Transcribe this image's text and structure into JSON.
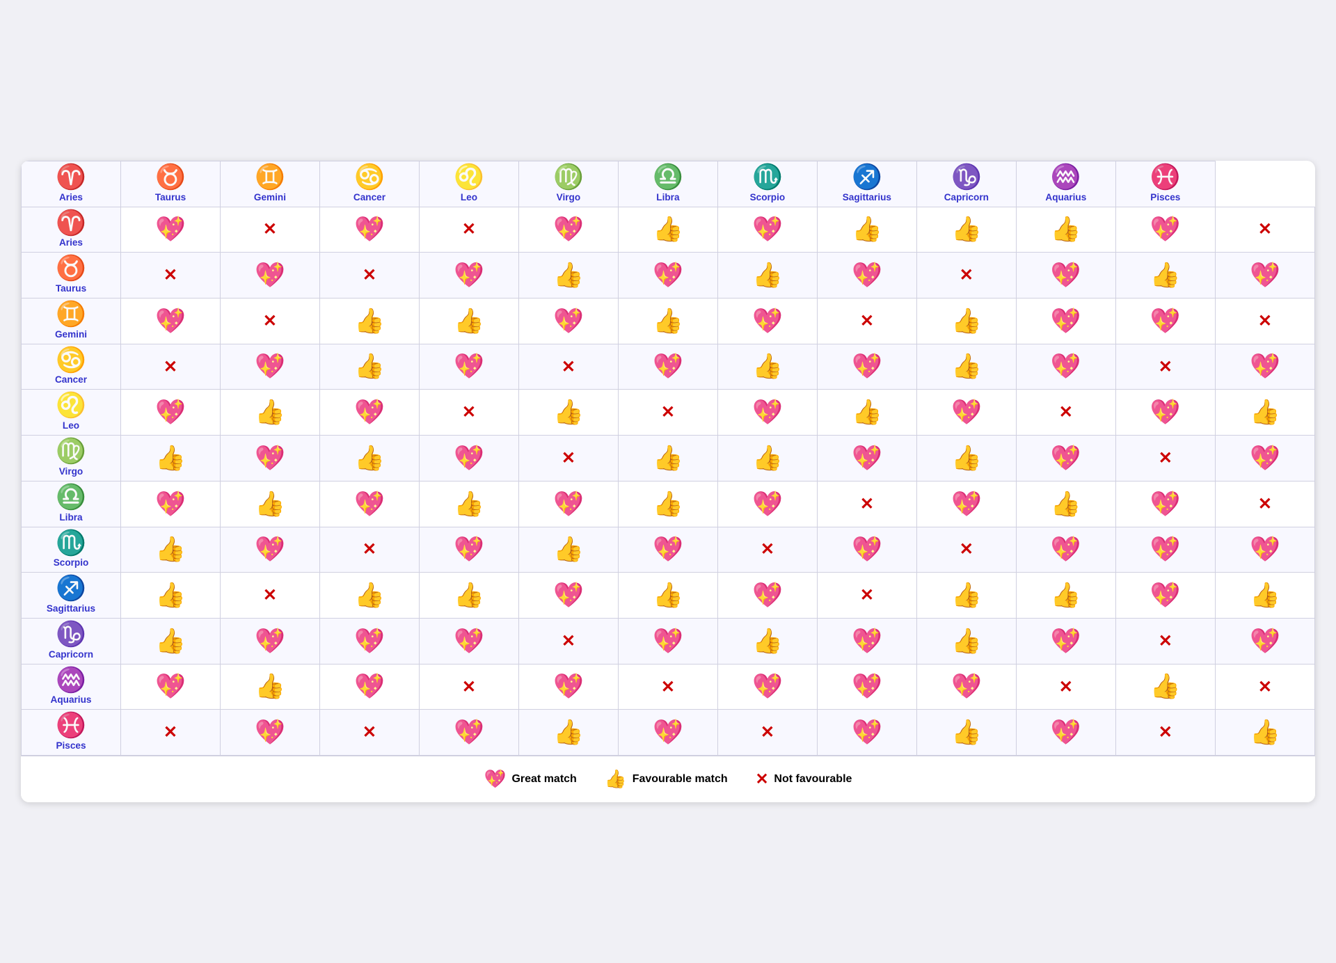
{
  "signs": [
    {
      "name": "Aries",
      "symbol": "♈"
    },
    {
      "name": "Taurus",
      "symbol": "♉"
    },
    {
      "name": "Gemini",
      "symbol": "♊"
    },
    {
      "name": "Cancer",
      "symbol": "♋"
    },
    {
      "name": "Leo",
      "symbol": "♌"
    },
    {
      "name": "Virgo",
      "symbol": "♍"
    },
    {
      "name": "Libra",
      "symbol": "♎"
    },
    {
      "name": "Scorpio",
      "symbol": "♏"
    },
    {
      "name": "Sagittarius",
      "symbol": "♐"
    },
    {
      "name": "Capricorn",
      "symbol": "♑"
    },
    {
      "name": "Aquarius",
      "symbol": "♒"
    },
    {
      "name": "Pisces",
      "symbol": "♓"
    }
  ],
  "matrix": [
    [
      "💖",
      "❌",
      "💖",
      "❌",
      "💖",
      "👍",
      "💖",
      "👍",
      "👍",
      "👍",
      "💖",
      "❌"
    ],
    [
      "❌",
      "💖",
      "❌",
      "💖",
      "👍",
      "💖",
      "👍",
      "💖",
      "❌",
      "💖",
      "👍",
      "💖"
    ],
    [
      "💖",
      "❌",
      "👍",
      "👍",
      "💖",
      "👍",
      "💖",
      "❌",
      "👍",
      "💖",
      "💖",
      "❌"
    ],
    [
      "❌",
      "💖",
      "👍",
      "💖",
      "❌",
      "💖",
      "👍",
      "💖",
      "👍",
      "💖",
      "❌",
      "💖"
    ],
    [
      "💖",
      "👍",
      "💖",
      "❌",
      "👍",
      "❌",
      "💖",
      "👍",
      "💖",
      "❌",
      "💖",
      "👍"
    ],
    [
      "👍",
      "💖",
      "👍",
      "💖",
      "❌",
      "👍",
      "👍",
      "💖",
      "👍",
      "💖",
      "❌",
      "💖"
    ],
    [
      "💖",
      "👍",
      "💖",
      "👍",
      "💖",
      "👍",
      "💖",
      "❌",
      "💖",
      "👍",
      "💖",
      "❌"
    ],
    [
      "👍",
      "💖",
      "❌",
      "💖",
      "👍",
      "💖",
      "❌",
      "💖",
      "❌",
      "💖",
      "💖",
      "💖"
    ],
    [
      "👍",
      "❌",
      "👍",
      "👍",
      "💖",
      "👍",
      "💖",
      "❌",
      "👍",
      "👍",
      "💖",
      "👍"
    ],
    [
      "👍",
      "💖",
      "💖",
      "💖",
      "❌",
      "💖",
      "👍",
      "💖",
      "👍",
      "💖",
      "❌",
      "💖"
    ],
    [
      "💖",
      "👍",
      "💖",
      "❌",
      "💖",
      "❌",
      "💖",
      "💖",
      "💖",
      "❌",
      "👍",
      "❌"
    ],
    [
      "❌",
      "💖",
      "❌",
      "💖",
      "👍",
      "💖",
      "❌",
      "💖",
      "👍",
      "💖",
      "❌",
      "👍"
    ]
  ],
  "legend": {
    "great_match_emoji": "💖",
    "great_match_label": "Great match",
    "favourable_emoji": "👍",
    "favourable_label": "Favourable match",
    "not_favourable_label": "Not favourable"
  }
}
